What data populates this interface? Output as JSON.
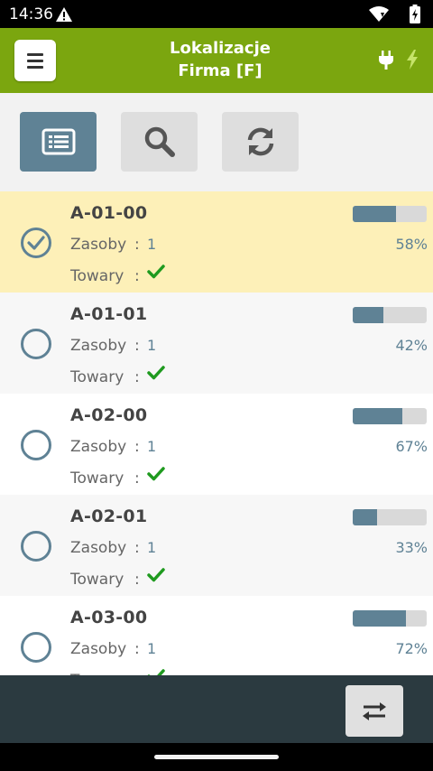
{
  "status_bar": {
    "time": "14:36",
    "icons": [
      "warning-icon",
      "wifi-icon",
      "battery-charging-icon"
    ]
  },
  "app_bar": {
    "title_line1": "Lokalizacje",
    "title_line2": "Firma [F]",
    "accent_color": "#7ba60f",
    "icons": [
      "menu-icon",
      "plug-icon",
      "bolt-icon"
    ]
  },
  "toolbar": {
    "buttons": [
      {
        "icon": "list-view-icon",
        "active": true
      },
      {
        "icon": "search-icon",
        "active": false
      },
      {
        "icon": "refresh-icon",
        "active": false
      }
    ],
    "active_color": "#5f8295"
  },
  "labels": {
    "zasoby": "Zasoby",
    "towary": "Towary",
    "colon": ":"
  },
  "locations": [
    {
      "code": "A-01-00",
      "zasoby": "1",
      "towary_ok": true,
      "progress": 0.58,
      "progress_text": "58%",
      "selected": true
    },
    {
      "code": "A-01-01",
      "zasoby": "1",
      "towary_ok": true,
      "progress": 0.42,
      "progress_text": "42%",
      "selected": false
    },
    {
      "code": "A-02-00",
      "zasoby": "1",
      "towary_ok": true,
      "progress": 0.67,
      "progress_text": "67%",
      "selected": false
    },
    {
      "code": "A-02-01",
      "zasoby": "1",
      "towary_ok": true,
      "progress": 0.33,
      "progress_text": "33%",
      "selected": false
    },
    {
      "code": "A-03-00",
      "zasoby": "1",
      "towary_ok": true,
      "progress": 0.72,
      "progress_text": "72%",
      "selected": false
    }
  ],
  "row_colors": {
    "selected": "#fdf0b8",
    "odd": "#f7f7f7",
    "even": "#ffffff"
  },
  "bottom_bar": {
    "action_icon": "swap-icon",
    "background": "#2b3a40"
  }
}
